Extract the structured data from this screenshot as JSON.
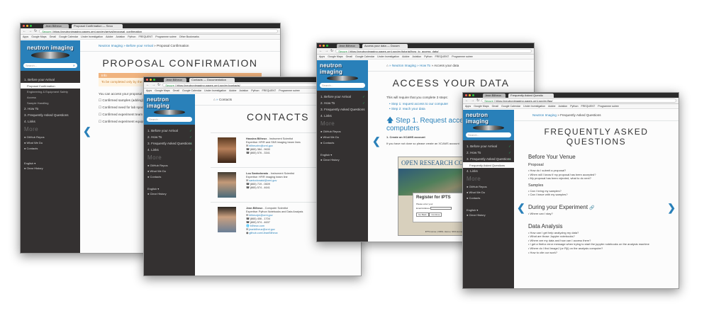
{
  "colors": {
    "sidebar_bg": "#343131",
    "header_blue": "#2980b9",
    "link_blue": "#2980b9",
    "info_orange": "#f0b37e",
    "check_green": "#27ae60"
  },
  "common": {
    "logo_text": "neutron imaging",
    "search_placeholder": "Search...",
    "secure_label": "Secure",
    "more_label": "More",
    "github_repos": "GitHub Repos",
    "what_we_do": "What We Do",
    "contacts": "Contacts",
    "language": "English",
    "clear_history": "Clear History",
    "nav_before": "1. Before your Arrival",
    "nav_howto": "2. How To",
    "nav_faq": "3. Frequently Asked Questions",
    "nav_links": "4. Links",
    "icons": [
      "search-icon",
      "close-icon",
      "chevron-left-icon",
      "chevron-right-icon",
      "checkmark-icon",
      "github-icon",
      "home-icon",
      "arrow-up-icon"
    ]
  },
  "win1": {
    "tab_user": "Jean Bilheux",
    "tab_title": "Proposal Confirmation — Secu",
    "url": "https://neutronimaging.pages.ornl.gov/en/arrival/proposal_confirmation",
    "bookmarks": [
      "Apps",
      "Google Maps",
      "Gmail",
      "Google Calendar",
      "Under Investigation",
      "Adobe",
      "Aviation",
      "Python",
      "FREQUENT",
      "Programme soiree",
      "Other Bookmarks"
    ],
    "sub_items": [
      "Proposal Confirmation",
      "Engineering & Equipment Safety",
      "Access",
      "Sample Handling"
    ],
    "crumb_home": "Neutron Imaging",
    "crumb_mid": "Before your Arrival",
    "crumb_last": "Proposal Confirmation",
    "title": "PROPOSAL CONFIRMATION",
    "info_head": "Info",
    "info_body": "To be completed only by the beam time.",
    "access_text": "You can access your proposal",
    "checks": [
      "Confirmed samples (adding)",
      "Confirmed need for lab spac",
      "Confirmed experiment team",
      "Confirmed experiment equip"
    ]
  },
  "win2": {
    "tab_user": "Jean Bilheux",
    "tab_title": "Contacts — Documentation",
    "url": "https://neutronimaging.pages.ornl.gov/en/contacts/",
    "bookmarks": [
      "Apps",
      "Google Maps",
      "Gmail",
      "Google Calendar",
      "Under Investigation",
      "Adobe",
      "Aviation",
      "Python",
      "FREQUENT",
      "Programme soiree"
    ],
    "crumb_last": "Contacts",
    "title": "CONTACTS",
    "contacts": [
      {
        "name": "Hassina Bilheux",
        "role": " - Instrument Scientist",
        "expertise": "Expertise: HFIR and SNS imaging beam lines",
        "email": "bilheuxhn@ornl.gov",
        "phone": "(865) 384 - 9630",
        "fax": "(865) 576 - 3341"
      },
      {
        "name": "Lou Santodonato",
        "role": " - Instrument Scientist",
        "expertise": "Expertise: HFIR imaging beam line",
        "email": "santodonatol@ornl.gov",
        "phone": "(865) 719 - 0609",
        "fax": "(865) 574 - 4641"
      },
      {
        "name": "Jean Bilheux",
        "role": " - Computer Scientist",
        "expertise": "Expertise: Python Notebooks and Data Analysis",
        "email": "bilheuxjm@ornl.gov",
        "phone": "(865) 406 - 1704",
        "fax": "(865) 574 - 4637",
        "site": "bilheux.com",
        "alt_email": "jeanbilheux@ornl.gov",
        "github": "github.com/JeanBilheux"
      }
    ]
  },
  "win3": {
    "tab_user": "Jean Bilheux",
    "tab_title": "Access your data — Docum",
    "url": "https://neutronimaging.pages.ornl.gov/en/tutorial/how_to_access_data/",
    "crumb_home": "Neutron Imaging",
    "crumb_mid": "How To",
    "crumb_last": "Access your data",
    "title": "ACCESS YOUR DATA",
    "lede": "This will require that you complete 3 steps:",
    "steps": [
      "Step 1: request access to our computer",
      "Step 2: reach your data"
    ],
    "step1": "Step 1. Request access to our computers",
    "create_account": "1. Create an XCAMS account",
    "xcams_note": "If you have not done so please create an XCAMS account",
    "orc_title": "OPEN RESEARCH COLLA",
    "register": "Register for IPTS",
    "email_label": "Please enter your",
    "email_label2": "Email Address",
    "buttons": [
      "Go Back",
      "Continue"
    ],
    "footer": "IPTS Home | ORNL Home | SNS Home | CNMS Home"
  },
  "win4": {
    "tab_user": "Jean Bilheux",
    "tab_title": "Frequently Asked Questio",
    "url": "https://neutronimaging.pages.ornl.gov/en/faq/",
    "crumb_home": "Neutron Imaging",
    "crumb_last": "Frequently Asked Questions",
    "title": "FREQUENTLY ASKED QUESTIONS",
    "sub_items": [
      "Frequently Asked Questions"
    ],
    "venue": "Before Your Venue",
    "proposal": "Proposal",
    "proposal_q": [
      "How do I submit a proposal?",
      "When will I know if my proposal has been accepted?",
      "My proposal has been rejected, what to do next?"
    ],
    "samples": "Samples",
    "samples_q": [
      "Can I bring my samples?",
      "Can I leave with my samples?"
    ],
    "during": "During your Experiment",
    "during_q": [
      "Where can I stay?"
    ],
    "analysis": "Data Analysis",
    "analysis_q": [
      "How can I get help analyzing my data?",
      "What are those Jupyter notebooks?",
      "Where are my data and how can I access them?",
      "I get a firefox error message when trying to start the jupyter notebooks on the analysis machine",
      "Where do I find ImageJ (or Fiji) on the analysis computer?",
      "How to cite our work?"
    ]
  }
}
